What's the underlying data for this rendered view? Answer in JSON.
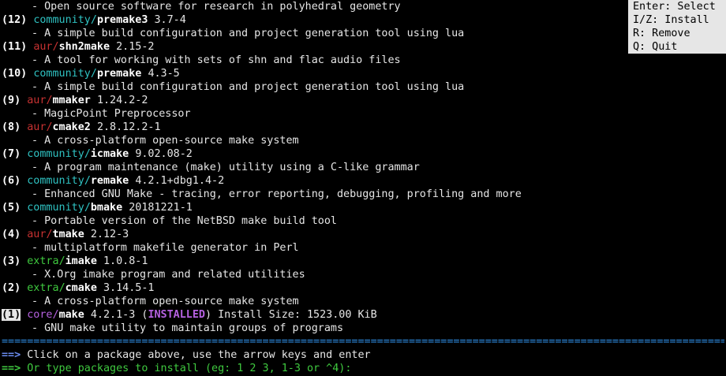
{
  "colors": {
    "community": "#2fc2c2",
    "aur": "#c83232",
    "extra": "#3fc93f",
    "core": "#b561e0",
    "installed": "#b561e0",
    "separator": "#2f8fe8",
    "prompt_arrow_blue": "#6a8cf0",
    "prompt_arrow_green": "#3fc93f"
  },
  "top_desc": "- Open source software for research in polyhedral geometry",
  "packages": [
    {
      "num": "(12)",
      "repo": "community",
      "name": "premake3",
      "version": "3.7-4",
      "desc": "- A simple build configuration and project generation tool using lua"
    },
    {
      "num": "(11)",
      "repo": "aur",
      "name": "shn2make",
      "version": "2.15-2",
      "desc": "- A tool for working with sets of shn and flac audio files"
    },
    {
      "num": "(10)",
      "repo": "community",
      "name": "premake",
      "version": "4.3-5",
      "desc": "- A simple build configuration and project generation tool using lua"
    },
    {
      "num": "(9)",
      "repo": "aur",
      "name": "mmaker",
      "version": "1.24.2-2",
      "desc": "- MagicPoint Preprocessor"
    },
    {
      "num": "(8)",
      "repo": "aur",
      "name": "cmake2",
      "version": "2.8.12.2-1",
      "desc": "- A cross-platform open-source make system"
    },
    {
      "num": "(7)",
      "repo": "community",
      "name": "icmake",
      "version": "9.02.08-2",
      "desc": "- A program maintenance (make) utility using a C-like grammar"
    },
    {
      "num": "(6)",
      "repo": "community",
      "name": "remake",
      "version": "4.2.1+dbg1.4-2",
      "desc": "- Enhanced GNU Make - tracing, error reporting, debugging, profiling and more"
    },
    {
      "num": "(5)",
      "repo": "community",
      "name": "bmake",
      "version": "20181221-1",
      "desc": "- Portable version of the NetBSD make build tool"
    },
    {
      "num": "(4)",
      "repo": "aur",
      "name": "tmake",
      "version": "2.12-3",
      "desc": "- multiplatform makefile generator in Perl"
    },
    {
      "num": "(3)",
      "repo": "extra",
      "name": "imake",
      "version": "1.0.8-1",
      "desc": "- X.Org imake program and related utilities"
    },
    {
      "num": "(2)",
      "repo": "extra",
      "name": "cmake",
      "version": "3.14.5-1",
      "desc": "- A cross-platform open-source make system"
    },
    {
      "num": "(1)",
      "repo": "core",
      "name": "make",
      "version": "4.2.1-3",
      "installed_label": "INSTALLED",
      "install_size": "Install Size: 1523.00 KiB",
      "desc": "- GNU make utility to maintain groups of programs",
      "selected": true
    }
  ],
  "separator_char": "=",
  "prompt": {
    "arrow": "==>",
    "line1": "Click on a package above, use the arrow keys and enter",
    "line2": "Or type packages to install (eg: 1 2 3, 1-3 or ^4):"
  },
  "help": [
    "Enter: Select",
    "I/Z: Install",
    "R: Remove",
    "Q: Quit"
  ]
}
